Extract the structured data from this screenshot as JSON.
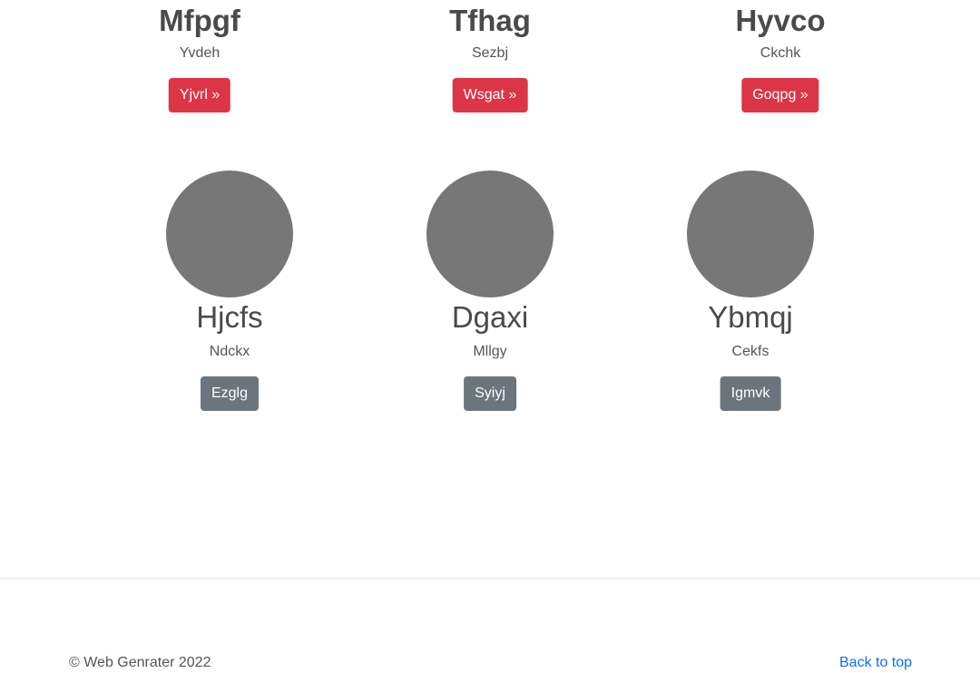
{
  "top_cards": [
    {
      "title": "Mfpgf",
      "subtitle": "Yvdeh",
      "button": "Yjvrl »"
    },
    {
      "title": "Tfhag",
      "subtitle": "Sezbj",
      "button": "Wsgat »"
    },
    {
      "title": "Hyvco",
      "subtitle": "Ckchk",
      "button": "Goqpg »"
    }
  ],
  "profile_cards": [
    {
      "name": "Hjcfs",
      "subtitle": "Ndckx",
      "button": "Ezglg"
    },
    {
      "name": "Dgaxi",
      "subtitle": "Mllgy",
      "button": "Syiyj"
    },
    {
      "name": "Ybmqj",
      "subtitle": "Cekfs",
      "button": "Igmvk"
    }
  ],
  "footer": {
    "copyright": "© Web Genrater 2022",
    "back_to_top": "Back to top"
  },
  "colors": {
    "primary_button": "#dc3545",
    "secondary_button": "#6c757d",
    "placeholder_circle": "#777777",
    "link": "#0d6efd"
  }
}
